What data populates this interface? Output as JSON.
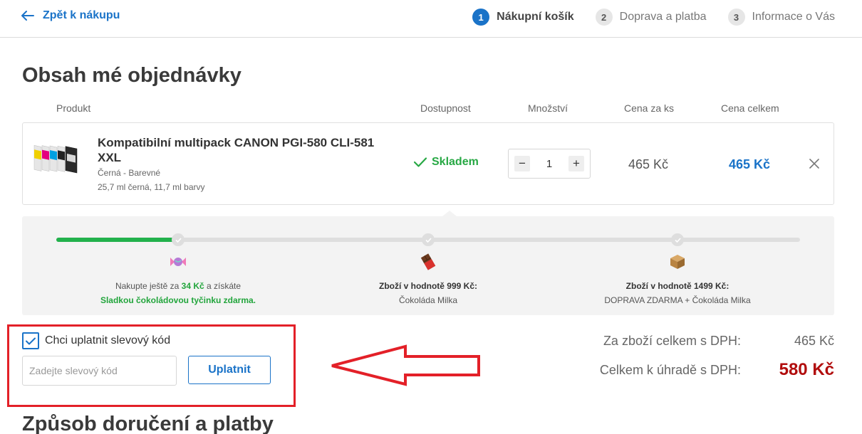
{
  "header": {
    "back_label": "Zpět k nákupu",
    "steps": [
      {
        "num": "1",
        "label": "Nákupní košík"
      },
      {
        "num": "2",
        "label": "Doprava a platba"
      },
      {
        "num": "3",
        "label": "Informace o Vás"
      }
    ]
  },
  "page_title": "Obsah mé objednávky",
  "columns": {
    "product": "Produkt",
    "availability": "Dostupnost",
    "quantity": "Množství",
    "unit_price": "Cena za ks",
    "total_price": "Cena celkem"
  },
  "item": {
    "name": "Kompatibilní multipack CANON PGI-580 CLI-581 XXL",
    "variant": "Černá - Barevné",
    "description": "25,7 ml černá, 11,7 ml barvy",
    "stock": "Skladem",
    "quantity": "1",
    "qty_minus": "−",
    "qty_plus": "+",
    "unit_price": "465 Kč",
    "total_price": "465 Kč"
  },
  "progress": {
    "fill_percent": 16.5,
    "milestones": [
      {
        "icon": "candy-icon",
        "line1_prefix": "Nakupte ještě za ",
        "line1_amount": "34 Kč",
        "line1_suffix": " a získáte",
        "line2": "Sladkou čokoládovou tyčinku zdarma."
      },
      {
        "icon": "chocolate-icon",
        "line1": "Zboží v hodnotě 999 Kč:",
        "line2": "Čokoláda Milka"
      },
      {
        "icon": "package-icon",
        "line1": "Zboží v hodnotě 1499 Kč:",
        "line2": "DOPRAVA ZDARMA + Čokoláda Milka"
      }
    ]
  },
  "discount": {
    "checkbox_label": "Chci uplatnit slevový kód",
    "checked": true,
    "input_placeholder": "Zadejte slevový kód",
    "input_value": "",
    "apply_label": "Uplatnit"
  },
  "summary": {
    "goods_label": "Za zboží celkem s DPH:",
    "goods_value": "465 Kč",
    "total_label": "Celkem k úhradě s DPH:",
    "total_value": "580 Kč"
  },
  "section2_title": "Způsob doručení a platby",
  "colors": {
    "accent": "#1a73c8",
    "success": "#22b14c",
    "total": "#b10d0d",
    "highlight": "#e32028"
  }
}
